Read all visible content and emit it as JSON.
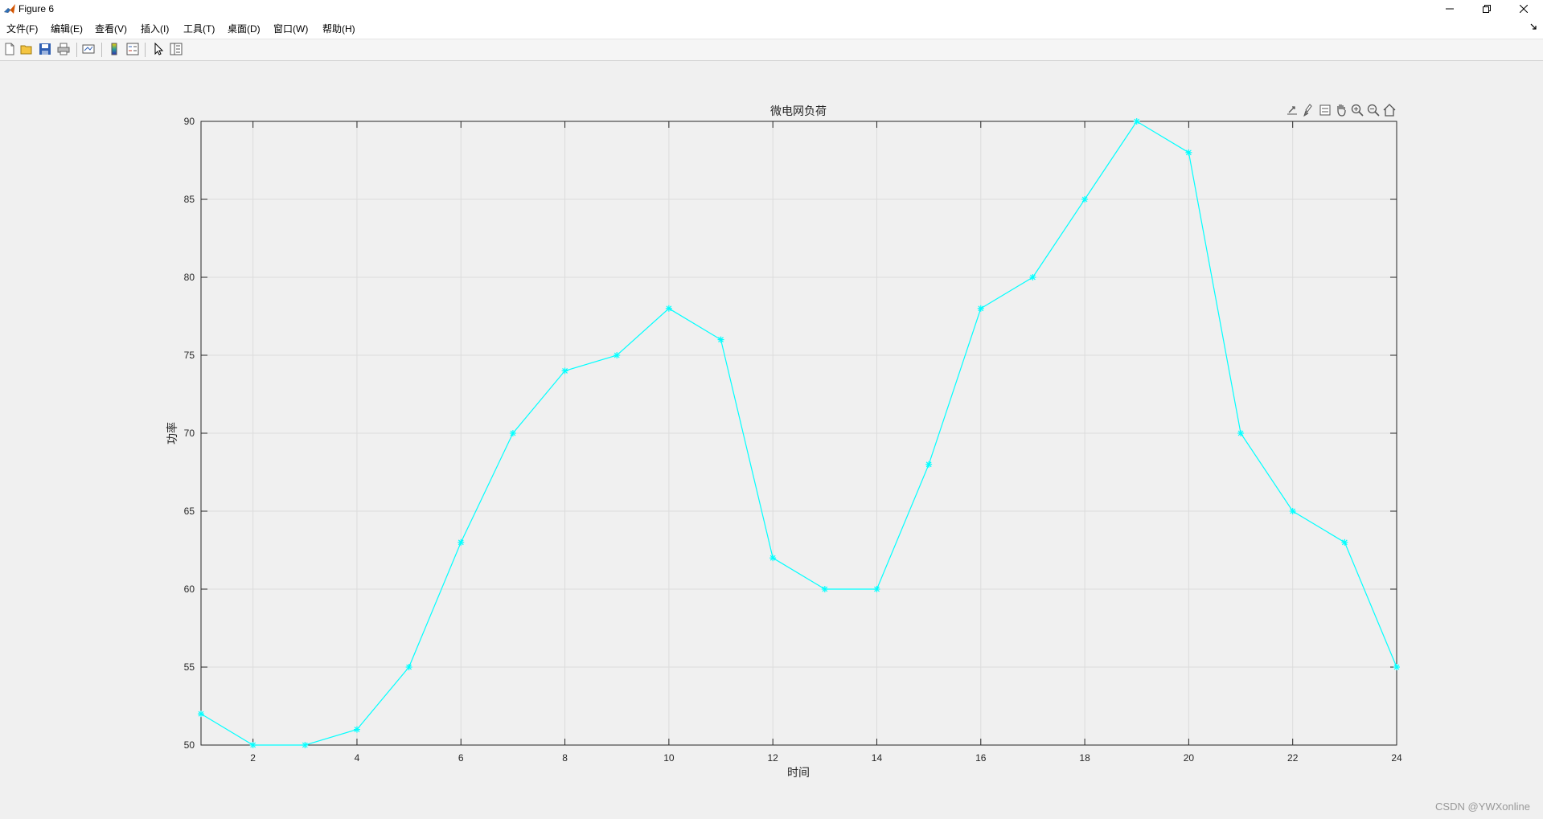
{
  "window": {
    "title": "Figure 6",
    "icon": "matlab-icon"
  },
  "menu": [
    {
      "label": "文件(F)"
    },
    {
      "label": "编辑(E)"
    },
    {
      "label": "查看(V)"
    },
    {
      "label": "插入(I)"
    },
    {
      "label": "工具(T)"
    },
    {
      "label": "桌面(D)"
    },
    {
      "label": "窗口(W)"
    },
    {
      "label": "帮助(H)"
    }
  ],
  "toolbar": {
    "icons": [
      "new-figure-icon",
      "open-file-icon",
      "save-icon",
      "print-icon",
      "link-plot-icon",
      "colorbar-icon",
      "legend-icon",
      "edit-plot-icon",
      "property-inspector-icon"
    ]
  },
  "axes_toolbar": {
    "icons": [
      "export-icon",
      "brush-icon",
      "datatip-icon",
      "pan-icon",
      "zoom-in-icon",
      "zoom-out-icon",
      "home-icon"
    ]
  },
  "chart_data": {
    "type": "line",
    "title": "微电网负荷",
    "xlabel": "时间",
    "ylabel": "功率",
    "x": [
      1,
      2,
      3,
      4,
      5,
      6,
      7,
      8,
      9,
      10,
      11,
      12,
      13,
      14,
      15,
      16,
      17,
      18,
      19,
      20,
      21,
      22,
      23,
      24
    ],
    "series": [
      {
        "values": [
          52,
          50,
          50,
          51,
          55,
          63,
          70,
          74,
          75,
          78,
          76,
          62,
          60,
          60,
          68,
          78,
          80,
          85,
          90,
          88,
          70,
          65,
          63,
          55
        ],
        "color": "#00ffff",
        "marker": "*"
      }
    ],
    "xlim": [
      1,
      24
    ],
    "ylim": [
      50,
      90
    ],
    "xticks": [
      2,
      4,
      6,
      8,
      10,
      12,
      14,
      16,
      18,
      20,
      22,
      24
    ],
    "yticks": [
      50,
      55,
      60,
      65,
      70,
      75,
      80,
      85,
      90
    ],
    "grid": true,
    "box": true
  },
  "watermark": "CSDN @YWXonline"
}
